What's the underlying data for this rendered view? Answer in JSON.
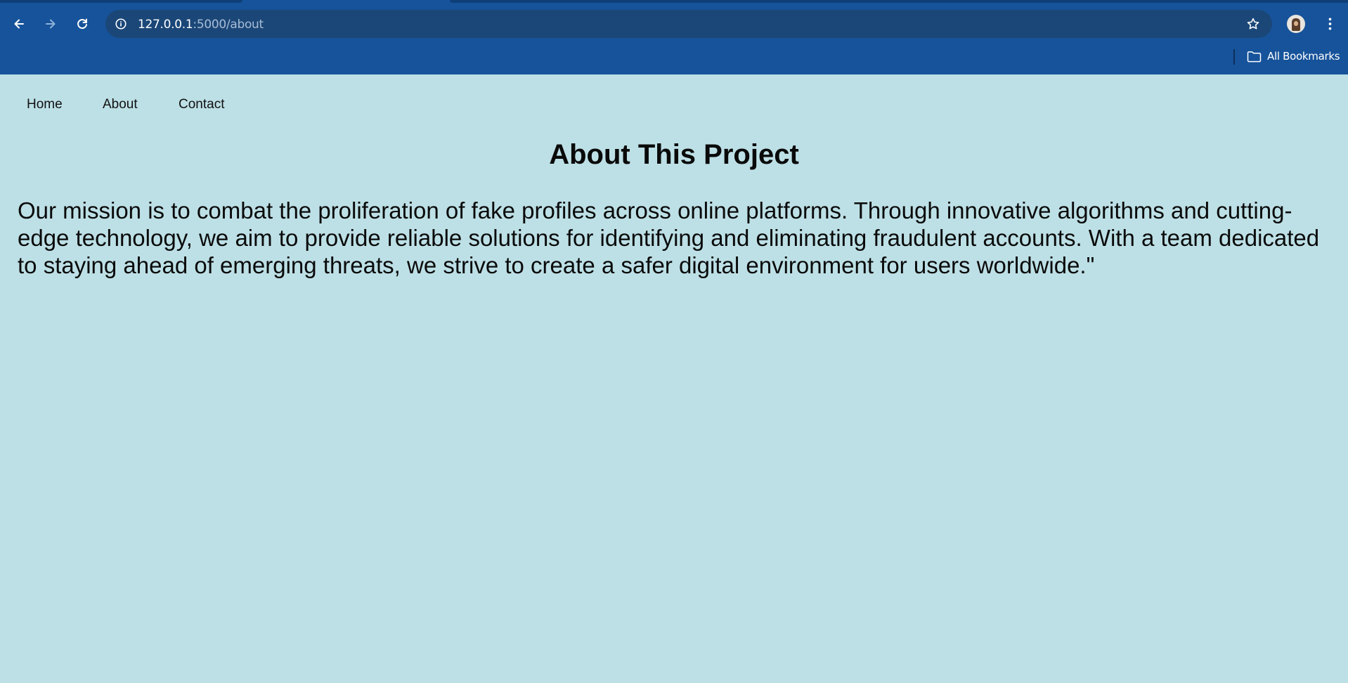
{
  "browser": {
    "url_host": "127.0.0.1",
    "url_path": ":5000/about",
    "bookmarks_label": "All Bookmarks",
    "icons": {
      "back": "arrow-left-icon",
      "forward": "arrow-right-icon",
      "reload": "reload-icon",
      "site_info": "info-icon",
      "bookmark_star": "star-icon",
      "profile": "avatar",
      "menu": "kebab-menu-icon",
      "bookmarks_folder": "folder-icon"
    },
    "colors": {
      "toolbar": "#16539a",
      "omnibox": "#1b4778"
    }
  },
  "site": {
    "nav": {
      "home": "Home",
      "about": "About",
      "contact": "Contact"
    },
    "title": "About This Project",
    "body": "Our mission is to combat the proliferation of fake profiles across online platforms. Through innovative algorithms and cutting-edge technology, we aim to provide reliable solutions for identifying and eliminating fraudulent accounts. With a team dedicated to staying ahead of emerging threats, we strive to create a safer digital environment for users worldwide.\"",
    "colors": {
      "background": "#bde0e6",
      "text": "#0a0a0a"
    }
  }
}
